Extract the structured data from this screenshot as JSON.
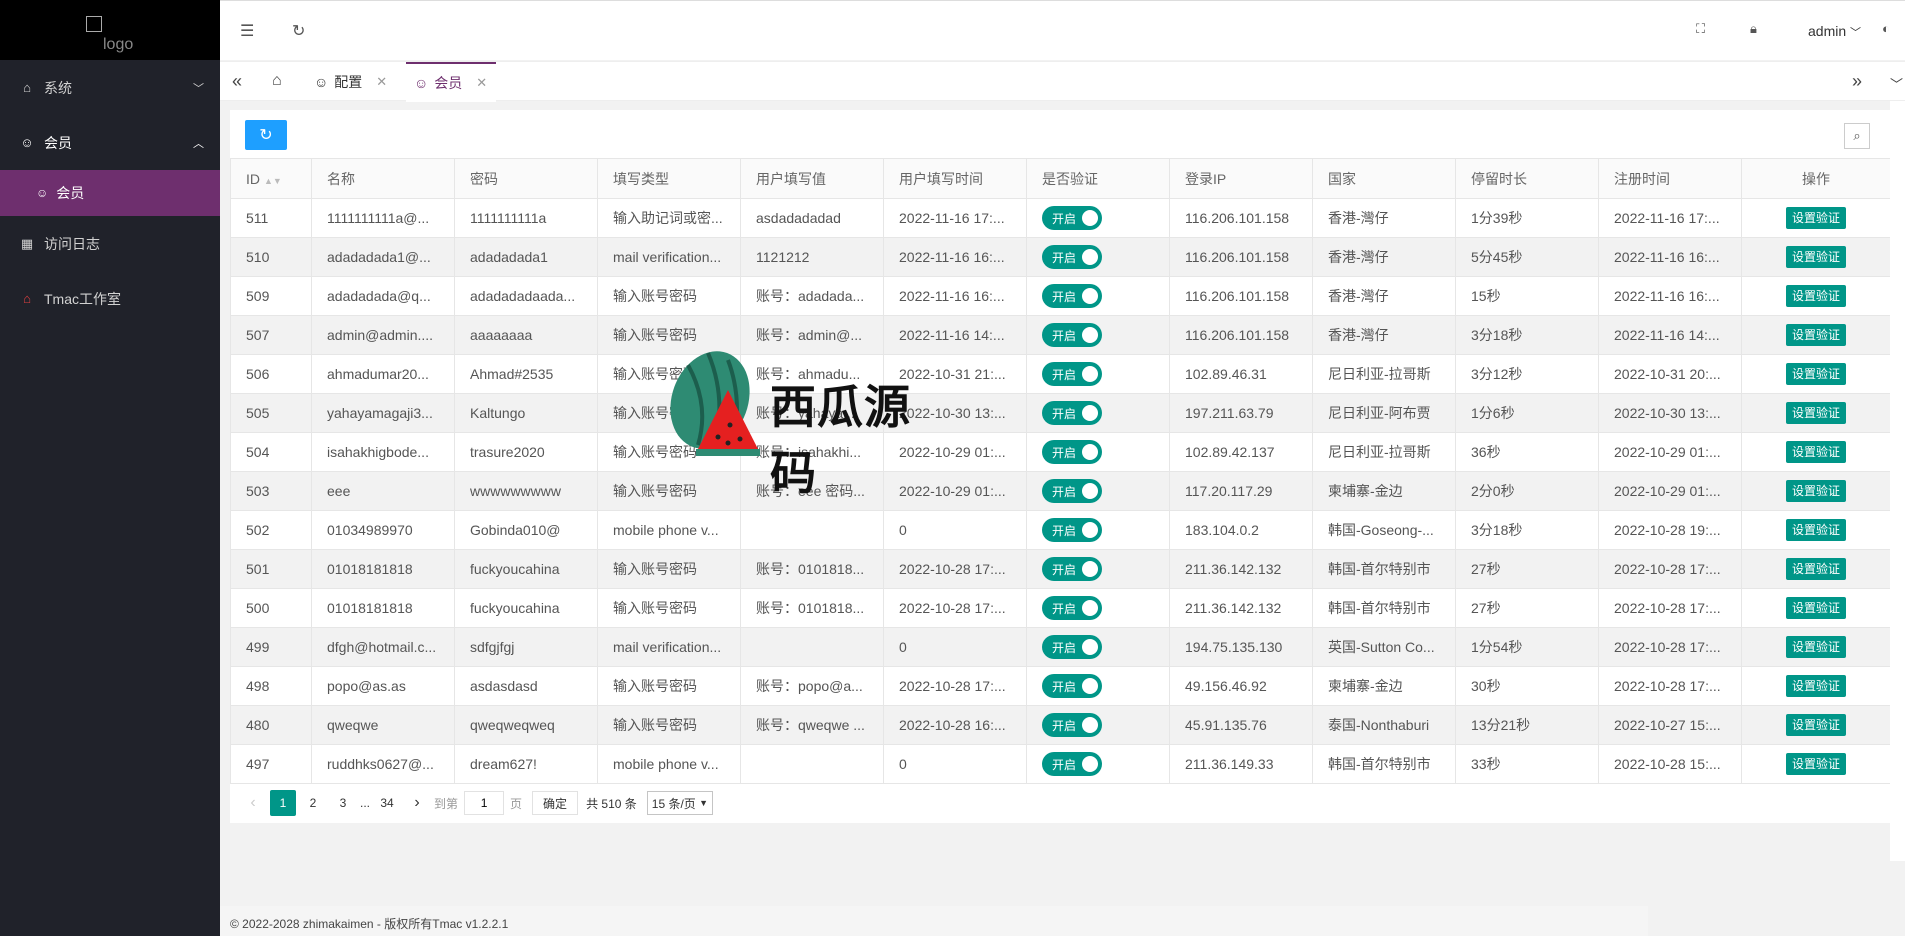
{
  "sidebar": {
    "logo_alt": "logo",
    "items": [
      {
        "label": "系统"
      },
      {
        "label": "会员"
      },
      {
        "label": "会员"
      },
      {
        "label": "访问日志"
      },
      {
        "label": "Tmac工作室"
      }
    ]
  },
  "header": {
    "user": "admin"
  },
  "tabs": [
    {
      "label": "配置"
    },
    {
      "label": "会员"
    }
  ],
  "table": {
    "columns": [
      "ID",
      "名称",
      "密码",
      "填写类型",
      "用户填写值",
      "用户填写时间",
      "是否验证",
      "登录IP",
      "国家",
      "停留时长",
      "注册时间",
      "操作"
    ],
    "toggle_label": "开启",
    "action_label": "设置验证",
    "rows": [
      [
        "511",
        "1111111111a@...",
        "1111111111a",
        "输入助记词或密...",
        "asdadadadad",
        "2022-11-16 17:...",
        "116.206.101.158",
        "香港-灣仔",
        "1分39秒",
        "2022-11-16 17:..."
      ],
      [
        "510",
        "adadadada1@...",
        "adadadada1",
        "mail verification...",
        "1121212",
        "2022-11-16 16:...",
        "116.206.101.158",
        "香港-灣仔",
        "5分45秒",
        "2022-11-16 16:..."
      ],
      [
        "509",
        "adadadada@q...",
        "adadadadaada...",
        "输入账号密码",
        "账号：adadada...",
        "2022-11-16 16:...",
        "116.206.101.158",
        "香港-灣仔",
        "15秒",
        "2022-11-16 16:..."
      ],
      [
        "507",
        "admin@admin....",
        "aaaaaaaa",
        "输入账号密码",
        "账号：admin@...",
        "2022-11-16 14:...",
        "116.206.101.158",
        "香港-灣仔",
        "3分18秒",
        "2022-11-16 14:..."
      ],
      [
        "506",
        "ahmadumar20...",
        "Ahmad#2535",
        "输入账号密码",
        "账号：ahmadu...",
        "2022-10-31 21:...",
        "102.89.46.31",
        "尼日利亚-拉哥斯",
        "3分12秒",
        "2022-10-31 20:..."
      ],
      [
        "505",
        "yahayamagaji3...",
        "Kaltungo",
        "输入账号密码",
        "账号：yahaya...",
        "2022-10-30 13:...",
        "197.211.63.79",
        "尼日利亚-阿布贾",
        "1分6秒",
        "2022-10-30 13:..."
      ],
      [
        "504",
        "isahakhigbode...",
        "trasure2020",
        "输入账号密码",
        "账号：isahakhi...",
        "2022-10-29 01:...",
        "102.89.42.137",
        "尼日利亚-拉哥斯",
        "36秒",
        "2022-10-29 01:..."
      ],
      [
        "503",
        "eee",
        "wwwwwwwww",
        "输入账号密码",
        "账号：eee 密码...",
        "2022-10-29 01:...",
        "117.20.117.29",
        "柬埔寨-金边",
        "2分0秒",
        "2022-10-29 01:..."
      ],
      [
        "502",
        "01034989970",
        "Gobinda010@",
        "mobile phone v...",
        "",
        "0",
        "183.104.0.2",
        "韩国-Goseong-...",
        "3分18秒",
        "2022-10-28 19:..."
      ],
      [
        "501",
        "01018181818",
        "fuckyoucahina",
        "输入账号密码",
        "账号：0101818...",
        "2022-10-28 17:...",
        "211.36.142.132",
        "韩国-首尔特别市",
        "27秒",
        "2022-10-28 17:..."
      ],
      [
        "500",
        "01018181818",
        "fuckyoucahina",
        "输入账号密码",
        "账号：0101818...",
        "2022-10-28 17:...",
        "211.36.142.132",
        "韩国-首尔特别市",
        "27秒",
        "2022-10-28 17:..."
      ],
      [
        "499",
        "dfgh@hotmail.c...",
        "sdfgjfgj",
        "mail verification...",
        "",
        "0",
        "194.75.135.130",
        "英国-Sutton Co...",
        "1分54秒",
        "2022-10-28 17:..."
      ],
      [
        "498",
        "popo@as.as",
        "asdasdasd",
        "输入账号密码",
        "账号：popo@a...",
        "2022-10-28 17:...",
        "49.156.46.92",
        "柬埔寨-金边",
        "30秒",
        "2022-10-28 17:..."
      ],
      [
        "480",
        "qweqwe",
        "qweqweqweq",
        "输入账号密码",
        "账号：qweqwe ...",
        "2022-10-28 16:...",
        "45.91.135.76",
        "泰国-Nonthaburi",
        "13分21秒",
        "2022-10-27 15:..."
      ],
      [
        "497",
        "ruddhks0627@...",
        "dream627!",
        "mobile phone v...",
        "",
        "0",
        "211.36.149.33",
        "韩国-首尔特别市",
        "33秒",
        "2022-10-28 15:..."
      ]
    ]
  },
  "pager": {
    "pages": [
      "1",
      "2",
      "3",
      "...",
      "34"
    ],
    "goto_prefix": "到第",
    "goto_value": "1",
    "goto_suffix": "页",
    "confirm": "确定",
    "total": "共 510 条",
    "per_page": "15 条/页"
  },
  "footer": "© 2022-2028 zhimakaimen - 版权所有Tmac v1.2.2.1",
  "watermark": "西瓜源码",
  "colors": {
    "sidebar": "#20222a",
    "active_menu": "#6e2f6e",
    "primary": "#009688",
    "refresh": "#1e9fff"
  }
}
